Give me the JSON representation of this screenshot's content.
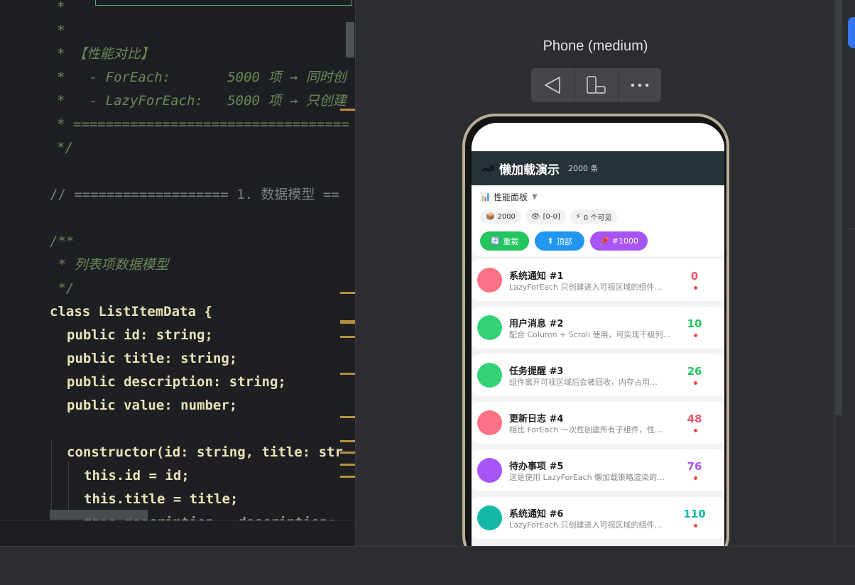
{
  "editor": {
    "lines": [
      "*",
      "*",
      "* 【性能对比】",
      "*   - ForEach:       5000 项 → 同时创",
      "*   - LazyForEach:   5000 项 → 只创建",
      "* ==================================",
      "*/",
      "",
      "// =================== 1. 数据模型 ==",
      "",
      "/**",
      " * 列表项数据模型",
      " */",
      "class ListItemData {",
      "public id: string;",
      "public title: string;",
      "public description: string;",
      "public value: number;",
      "",
      "constructor(id: string, title: str",
      "this.id = id;",
      "this.title = title;",
      "this.description = description;"
    ]
  },
  "preview": {
    "device_title": "Phone (medium)",
    "toolbar": {
      "back_icon": "back-triangle-icon",
      "rotate_icon": "rotate-device-icon",
      "more_icon": "more-dots-icon"
    }
  },
  "app": {
    "title_emoji": "🏎",
    "title": "懒加载演示",
    "count": "2000 条",
    "panel": {
      "icon": "📊",
      "label": "性能面板",
      "caret": "▼",
      "stats": [
        {
          "icon": "📦",
          "text": "2000"
        },
        {
          "icon": "👁",
          "text": "[0-0]"
        },
        {
          "icon": "⚡",
          "text": "0 个可见"
        }
      ],
      "actions": [
        {
          "icon": "🔄",
          "label": "重载",
          "color": "#22c55e"
        },
        {
          "icon": "⬆",
          "label": "顶部",
          "color": "#2196f3"
        },
        {
          "icon": "📌",
          "label": "#1000",
          "color": "#a855f7"
        }
      ]
    },
    "items": [
      {
        "title": "系统通知 #1",
        "desc": "LazyForEach 只创建进入可视区域的组件…",
        "value": "0",
        "avatar_color": "#fb7185",
        "value_color": "#f0566a"
      },
      {
        "title": "用户消息 #2",
        "desc": "配合 Column + Scroll 使用，可实现千级列…",
        "value": "10",
        "avatar_color": "#34d277",
        "value_color": "#22c55e"
      },
      {
        "title": "任务提醒 #3",
        "desc": "组件离开可视区域后会被回收，内存占用…",
        "value": "26",
        "avatar_color": "#34d277",
        "value_color": "#22c55e"
      },
      {
        "title": "更新日志 #4",
        "desc": "相比 ForEach 一次性创建所有子组件，性…",
        "value": "48",
        "avatar_color": "#fb7185",
        "value_color": "#f0566a"
      },
      {
        "title": "待办事项 #5",
        "desc": "这是使用 LazyForEach 懒加载策略渲染的…",
        "value": "76",
        "avatar_color": "#a855f7",
        "value_color": "#a855f7"
      },
      {
        "title": "系统通知 #6",
        "desc": "LazyForEach 只创建进入可视区域的组件…",
        "value": "110",
        "avatar_color": "#14b8a6",
        "value_color": "#14b8a6"
      }
    ]
  }
}
